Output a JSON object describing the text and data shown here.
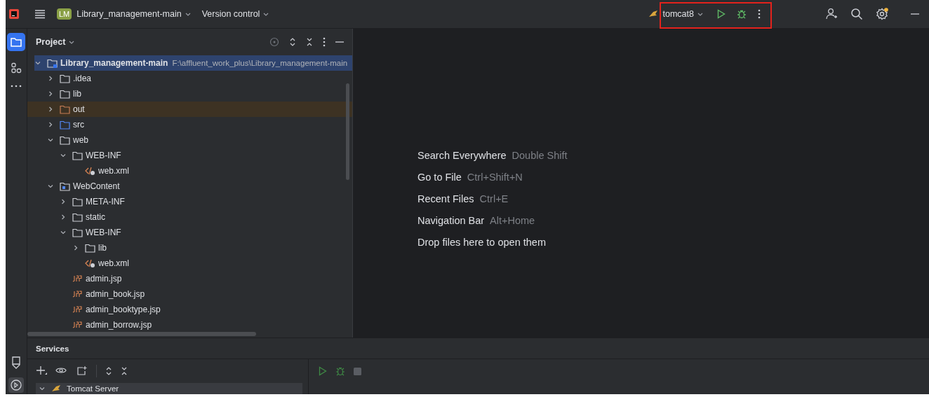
{
  "toolbar": {
    "project_badge": "LM",
    "project": "Library_management-main",
    "vcs": "Version control",
    "run_config": "tomcat8",
    "settings_notification": true
  },
  "project_panel": {
    "title": "Project",
    "tree": [
      {
        "kind": "project",
        "name": "Library_management-main",
        "path": "F:\\affluent_work_plus\\Library_management-main",
        "expanded": true,
        "selected": true,
        "children": [
          {
            "kind": "folder",
            "name": ".idea",
            "expanded": false,
            "selected": false
          },
          {
            "kind": "folder",
            "name": "lib",
            "expanded": false,
            "selected": false
          },
          {
            "kind": "excluded-folder",
            "name": "out",
            "expanded": false,
            "selected": false
          },
          {
            "kind": "source-folder",
            "name": "src",
            "expanded": false,
            "selected": false
          },
          {
            "kind": "folder",
            "name": "web",
            "expanded": true,
            "selected": false,
            "children": [
              {
                "kind": "folder",
                "name": "WEB-INF",
                "expanded": true,
                "selected": false,
                "children": [
                  {
                    "kind": "xml",
                    "name": "web.xml",
                    "selected": false
                  }
                ]
              }
            ]
          },
          {
            "kind": "web-folder",
            "name": "WebContent",
            "expanded": true,
            "selected": false,
            "children": [
              {
                "kind": "folder",
                "name": "META-INF",
                "expanded": false,
                "selected": false
              },
              {
                "kind": "folder",
                "name": "static",
                "expanded": false,
                "selected": false
              },
              {
                "kind": "folder",
                "name": "WEB-INF",
                "expanded": true,
                "selected": false,
                "children": [
                  {
                    "kind": "folder",
                    "name": "lib",
                    "expanded": false,
                    "selected": false
                  },
                  {
                    "kind": "xml",
                    "name": "web.xml",
                    "selected": false
                  }
                ]
              },
              {
                "kind": "jsp",
                "name": "admin.jsp",
                "selected": false
              },
              {
                "kind": "jsp",
                "name": "admin_book.jsp",
                "selected": false
              },
              {
                "kind": "jsp",
                "name": "admin_booktype.jsp",
                "selected": false
              },
              {
                "kind": "jsp",
                "name": "admin_borrow.jsp",
                "selected": false
              }
            ]
          }
        ]
      }
    ]
  },
  "editor_hints": [
    {
      "action": "Search Everywhere",
      "shortcut": "Double Shift"
    },
    {
      "action": "Go to File",
      "shortcut": "Ctrl+Shift+N"
    },
    {
      "action": "Recent Files",
      "shortcut": "Ctrl+E"
    },
    {
      "action": "Navigation Bar",
      "shortcut": "Alt+Home"
    },
    {
      "action": "Drop files here to open them"
    }
  ],
  "services": {
    "title": "Services",
    "tree": [
      {
        "name": "Tomcat Server",
        "expanded": true
      }
    ]
  }
}
